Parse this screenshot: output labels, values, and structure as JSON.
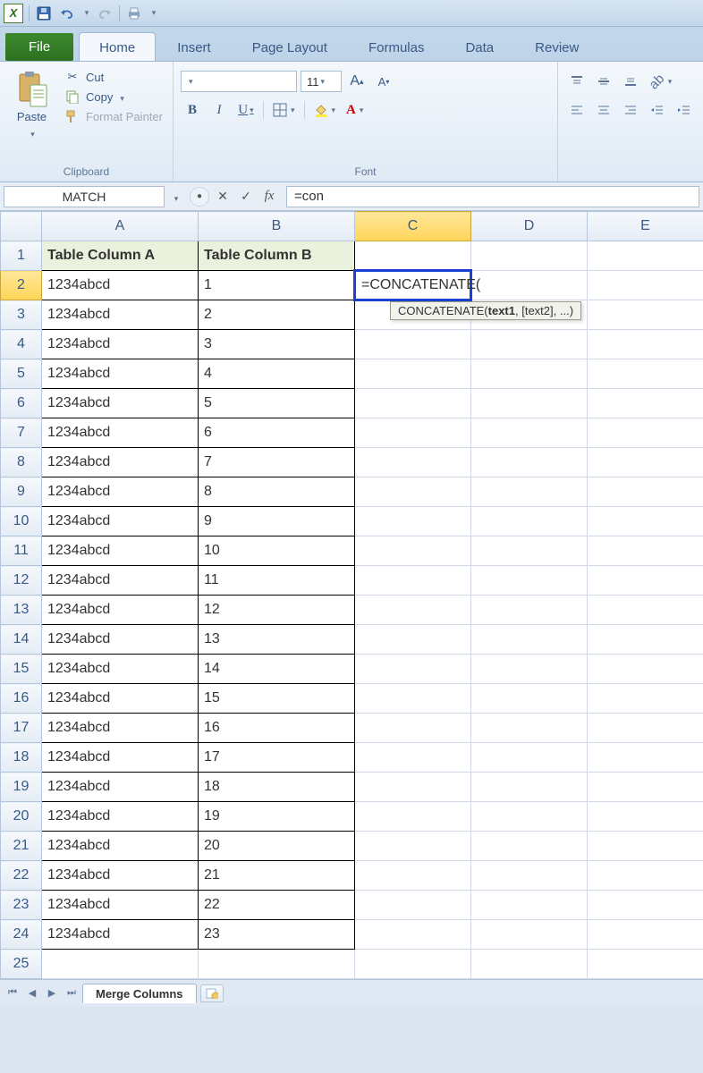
{
  "qat": {
    "appInitial": "X"
  },
  "tabs": {
    "file": "File",
    "items": [
      "Home",
      "Insert",
      "Page Layout",
      "Formulas",
      "Data",
      "Review"
    ],
    "activeIndex": 0
  },
  "ribbon": {
    "clipboard": {
      "paste": "Paste",
      "cut": "Cut",
      "copy": "Copy",
      "formatPainter": "Format Painter",
      "title": "Clipboard"
    },
    "font": {
      "title": "Font",
      "fontName": "",
      "fontSize": "11",
      "bold": "B",
      "italic": "I",
      "underline": "U",
      "increase": "A",
      "decrease": "A"
    }
  },
  "formulaBar": {
    "nameBox": "MATCH",
    "cancel": "✕",
    "enter": "✓",
    "fx": "fx",
    "formula": "=con"
  },
  "columns": [
    "A",
    "B",
    "C",
    "D",
    "E"
  ],
  "headers": {
    "A": "Table Column A",
    "B": "Table Column B"
  },
  "activeCell": {
    "row": 2,
    "col": "C",
    "text": "=CONCATENATE("
  },
  "tooltip": {
    "fn": "CONCATENATE(",
    "arg1": "text1",
    "rest": ", [text2], ...)"
  },
  "rows": [
    {
      "n": 1,
      "A": "Table Column A",
      "B": "Table Column B",
      "hdr": true
    },
    {
      "n": 2,
      "A": "1234abcd",
      "B": "1"
    },
    {
      "n": 3,
      "A": "1234abcd",
      "B": "2"
    },
    {
      "n": 4,
      "A": "1234abcd",
      "B": "3"
    },
    {
      "n": 5,
      "A": "1234abcd",
      "B": "4"
    },
    {
      "n": 6,
      "A": "1234abcd",
      "B": "5"
    },
    {
      "n": 7,
      "A": "1234abcd",
      "B": "6"
    },
    {
      "n": 8,
      "A": "1234abcd",
      "B": "7"
    },
    {
      "n": 9,
      "A": "1234abcd",
      "B": "8"
    },
    {
      "n": 10,
      "A": "1234abcd",
      "B": "9"
    },
    {
      "n": 11,
      "A": "1234abcd",
      "B": "10"
    },
    {
      "n": 12,
      "A": "1234abcd",
      "B": "11"
    },
    {
      "n": 13,
      "A": "1234abcd",
      "B": "12"
    },
    {
      "n": 14,
      "A": "1234abcd",
      "B": "13"
    },
    {
      "n": 15,
      "A": "1234abcd",
      "B": "14"
    },
    {
      "n": 16,
      "A": "1234abcd",
      "B": "15"
    },
    {
      "n": 17,
      "A": "1234abcd",
      "B": "16"
    },
    {
      "n": 18,
      "A": "1234abcd",
      "B": "17"
    },
    {
      "n": 19,
      "A": "1234abcd",
      "B": "18"
    },
    {
      "n": 20,
      "A": "1234abcd",
      "B": "19"
    },
    {
      "n": 21,
      "A": "1234abcd",
      "B": "20"
    },
    {
      "n": 22,
      "A": "1234abcd",
      "B": "21"
    },
    {
      "n": 23,
      "A": "1234abcd",
      "B": "22"
    },
    {
      "n": 24,
      "A": "1234abcd",
      "B": "23"
    },
    {
      "n": 25,
      "A": "",
      "B": ""
    }
  ],
  "footer": {
    "sheetName": "Merge Columns"
  }
}
